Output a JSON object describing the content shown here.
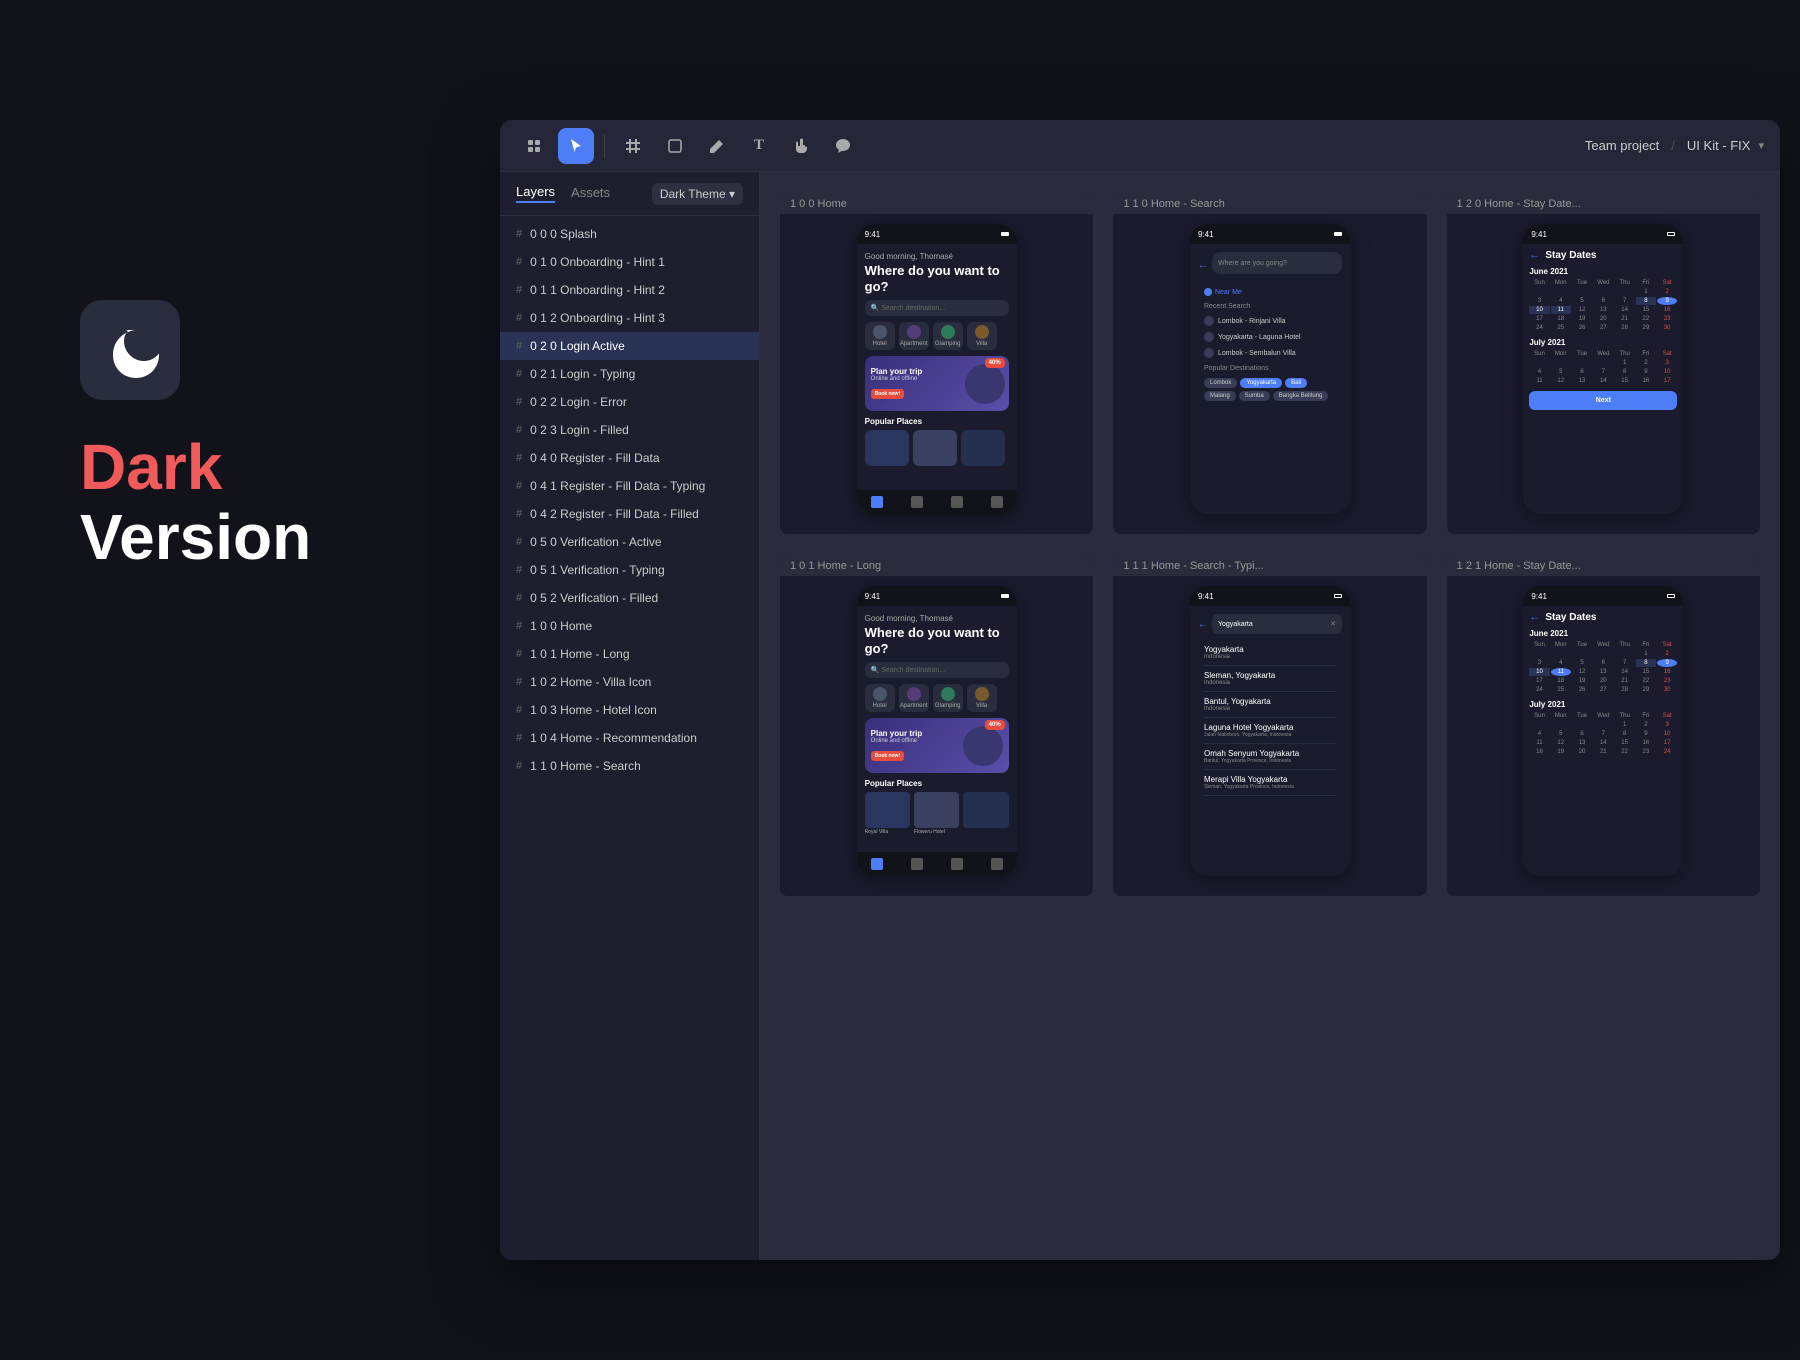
{
  "brand": {
    "dark_label": "Dark",
    "version_label": "Version"
  },
  "toolbar": {
    "breadcrumb": {
      "team": "Team project",
      "separator": "/",
      "file": "UI Kit - FIX",
      "chevron": "▾"
    },
    "tools": [
      {
        "name": "move-select-tool",
        "icon": "⊞",
        "active": false
      },
      {
        "name": "pointer-tool",
        "icon": "▶",
        "active": true
      },
      {
        "name": "frame-tool",
        "icon": "#",
        "active": false
      },
      {
        "name": "shape-tool",
        "icon": "□",
        "active": false
      },
      {
        "name": "pen-tool",
        "icon": "✒",
        "active": false
      },
      {
        "name": "text-tool",
        "icon": "T",
        "active": false
      },
      {
        "name": "hand-tool",
        "icon": "✋",
        "active": false
      },
      {
        "name": "comment-tool",
        "icon": "◯",
        "active": false
      }
    ]
  },
  "panel": {
    "tabs": [
      {
        "label": "Layers",
        "active": true
      },
      {
        "label": "Assets",
        "active": false
      }
    ],
    "theme_selector": "Dark Theme ▾",
    "layers": [
      {
        "hash": "#",
        "label": "0 0 0 Splash"
      },
      {
        "hash": "#",
        "label": "0 1 0 Onboarding - Hint 1"
      },
      {
        "hash": "#",
        "label": "0 1 1 Onboarding - Hint 2"
      },
      {
        "hash": "#",
        "label": "0 1 2 Onboarding - Hint 3"
      },
      {
        "hash": "#",
        "label": "0 2 0 Login Active",
        "selected": true
      },
      {
        "hash": "#",
        "label": "0 2 1 Login - Typing"
      },
      {
        "hash": "#",
        "label": "0 2 2 Login - Error"
      },
      {
        "hash": "#",
        "label": "0 2 3 Login - Filled"
      },
      {
        "hash": "#",
        "label": "0 4 0 Register - Fill Data"
      },
      {
        "hash": "#",
        "label": "0 4 1 Register - Fill Data - Typing"
      },
      {
        "hash": "#",
        "label": "0 4 2 Register - Fill Data - Filled"
      },
      {
        "hash": "#",
        "label": "0 5 0 Verification - Active"
      },
      {
        "hash": "#",
        "label": "0 5 1 Verification - Typing"
      },
      {
        "hash": "#",
        "label": "0 5 2 Verification - Filled"
      },
      {
        "hash": "#",
        "label": "1 0 0 Home"
      },
      {
        "hash": "#",
        "label": "1 0 1 Home - Long"
      },
      {
        "hash": "#",
        "label": "1 0 2 Home - Villa Icon"
      },
      {
        "hash": "#",
        "label": "1 0 3 Home - Hotel Icon"
      },
      {
        "hash": "#",
        "label": "1 0 4 Home - Recommendation"
      },
      {
        "hash": "#",
        "label": "1 1 0 Home - Search"
      }
    ]
  },
  "canvas": {
    "frames": [
      {
        "label": "1 0 0 Home",
        "type": "home"
      },
      {
        "label": "1 1 0 Home - Search",
        "type": "search"
      },
      {
        "label": "1 2 0 Home - Stay Date...",
        "type": "calendar"
      },
      {
        "label": "1 0 1 Home - Long",
        "type": "home-long"
      },
      {
        "label": "1 1 1 Home - Search - Typi...",
        "type": "search-typing"
      },
      {
        "label": "1 2 1 Home - Stay Date...",
        "type": "calendar2"
      }
    ]
  }
}
